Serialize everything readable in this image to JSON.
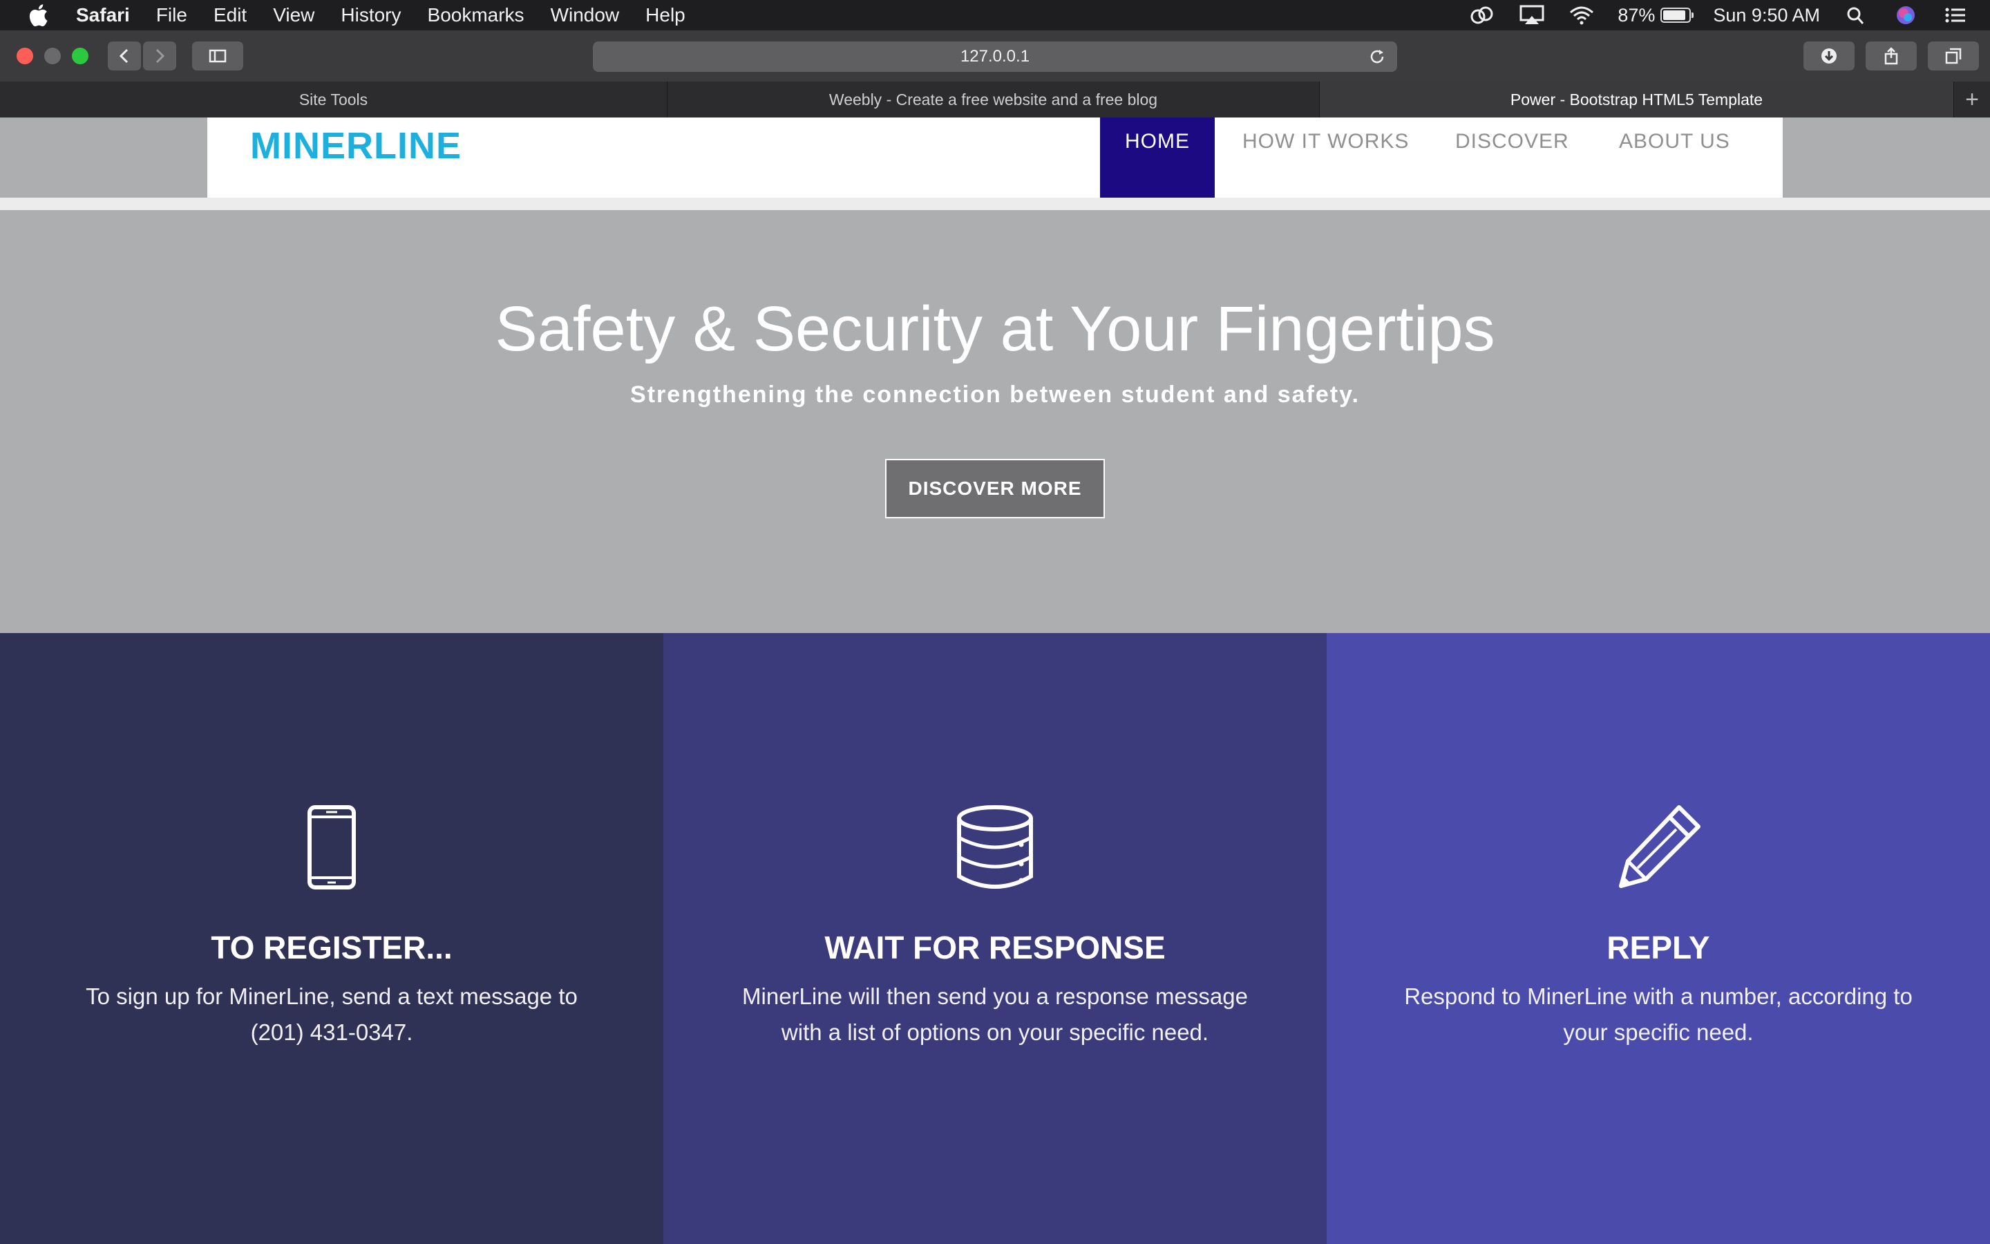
{
  "menubar": {
    "app_name": "Safari",
    "items": [
      "File",
      "Edit",
      "View",
      "History",
      "Bookmarks",
      "Window",
      "Help"
    ],
    "battery_percent": "87%",
    "battery_level": 0.87,
    "clock": "Sun 9:50 AM"
  },
  "browser": {
    "url": "127.0.0.1",
    "tabs": [
      {
        "label": "Site Tools"
      },
      {
        "label": "Weebly - Create a free website and a free blog"
      },
      {
        "label": "Power - Bootstrap HTML5 Template"
      }
    ],
    "new_tab_label": "+"
  },
  "site": {
    "logo": "MINERLINE",
    "nav": [
      {
        "label": "HOME"
      },
      {
        "label": "HOW IT WORKS"
      },
      {
        "label": "DISCOVER"
      },
      {
        "label": "ABOUT US"
      }
    ],
    "hero": {
      "title": "Safety & Security at Your Fingertips",
      "subtitle": "Strengthening the connection between student and safety.",
      "button": "DISCOVER MORE"
    },
    "features": [
      {
        "icon": "tablet-icon",
        "title": "TO REGISTER...",
        "text": "To sign up for MinerLine, send a text message to (201) 431-0347."
      },
      {
        "icon": "database-icon",
        "title": "WAIT FOR RESPONSE",
        "text": "MinerLine will then send you a response message with a list of options on your specific need."
      },
      {
        "icon": "pencil-icon",
        "title": "REPLY",
        "text": "Respond to MinerLine with a number, according to your specific need."
      }
    ]
  },
  "colors": {
    "logo": "#1db0df",
    "nav_active": "#1c0a82",
    "hero_bg": "#adaeb0",
    "feature_1": "#2f3254",
    "feature_2": "#3b3b7b",
    "feature_3": "#4a4bab"
  }
}
